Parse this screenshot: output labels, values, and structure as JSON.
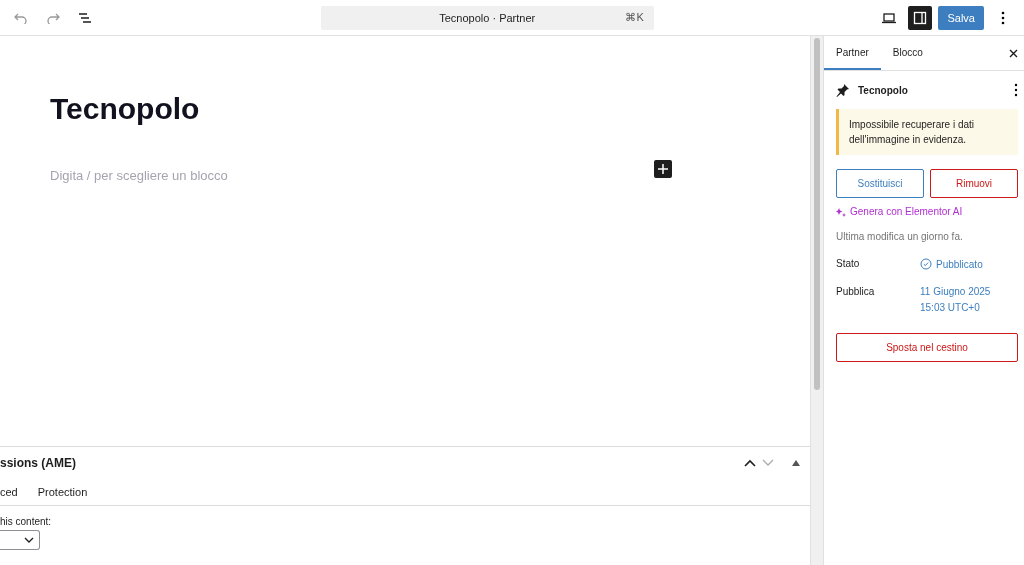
{
  "toolbar": {
    "command_bar": {
      "title": "Tecnopolo · Partner",
      "shortcut": "⌘K"
    },
    "sidebar_toggle_on": true,
    "save_label": "Salva"
  },
  "editor": {
    "title": "Tecnopolo",
    "placeholder": "Digita / per scegliere un blocco"
  },
  "metabox": {
    "title": "ssions (AME)",
    "tabs": [
      {
        "label": "ced",
        "selected": false
      },
      {
        "label": "Protection",
        "selected": false
      }
    ],
    "field_label": "his content:"
  },
  "sidebar": {
    "tabs": [
      {
        "label": "Partner",
        "selected": true
      },
      {
        "label": "Blocco",
        "selected": false
      }
    ],
    "post_title": "Tecnopolo",
    "notice": "Impossibile recuperare i dati dell'immagine in evidenza.",
    "replace_label": "Sostituisci",
    "remove_label": "Rimuovi",
    "ai_label": "Genera con Elementor AI",
    "last_modified": "Ultima modifica un giorno fa.",
    "rows": [
      {
        "label": "Stato",
        "kind": "status",
        "value": "Pubblicato"
      },
      {
        "label": "Pubblica",
        "kind": "date",
        "value": "11 Giugno 2025",
        "value2": "15:03 UTC+0"
      }
    ],
    "trash_label": "Sposta nel cestino"
  }
}
